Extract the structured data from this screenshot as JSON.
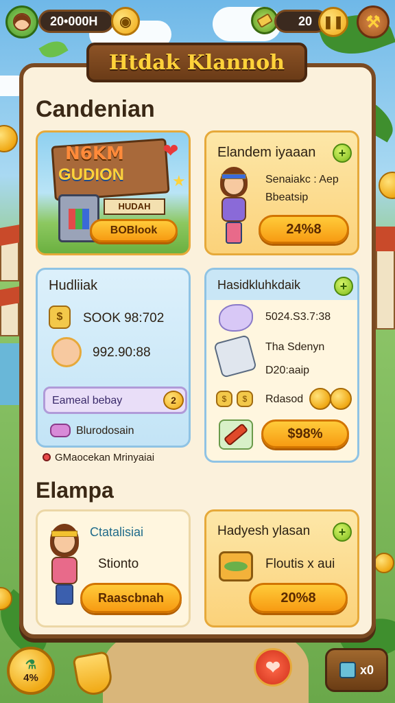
{
  "hud": {
    "player_currency": "20•000H",
    "right_counter": "20"
  },
  "title": "Htdak Klannoh",
  "section1": {
    "heading": "Candenian",
    "feature_card": {
      "logo_line1": "N6KM",
      "logo_line2": "GUDION",
      "logo_sign": "HUDAH",
      "button": "BOBlook"
    },
    "offer_card": {
      "title": "Elandem iyaaan",
      "desc_line1": "Senaiakc : Aep",
      "desc_line2": "Bbeatsip",
      "button": "24%8"
    },
    "stats_card": {
      "title": "Hudliiak",
      "row1": "SOOK 98:702",
      "row2": "992.90:88",
      "bar_label": "Eameal bebay",
      "bar_badge": "2",
      "footer": "Blurodosain"
    },
    "reward_card": {
      "title": "Hasidkluhkdaik",
      "row1": "5024.S3.7:38",
      "row2_line1": "Tha Sdenyn",
      "row2_line2": "D20:aaip",
      "row3": "Rdasod",
      "button": "$98%"
    },
    "note": "GMaocekan Mrinyaiai"
  },
  "section2": {
    "heading": "Elampa",
    "char_card": {
      "title": "Ctatalisiai",
      "subtitle": "Stionto",
      "button": "Raascbnah"
    },
    "deal_card": {
      "title": "Hadyesh ylasan",
      "subtitle": "Floutis x aui",
      "button": "20%8"
    }
  },
  "bottom": {
    "left_badge": "4%",
    "right_badge": "x0"
  },
  "colors": {
    "panel_border": "#7a4a22",
    "accent_orange": "#f79b12",
    "gold": "#ffd23a",
    "card_blue": "#c3e4f6",
    "card_yellow": "#fbd27a"
  }
}
